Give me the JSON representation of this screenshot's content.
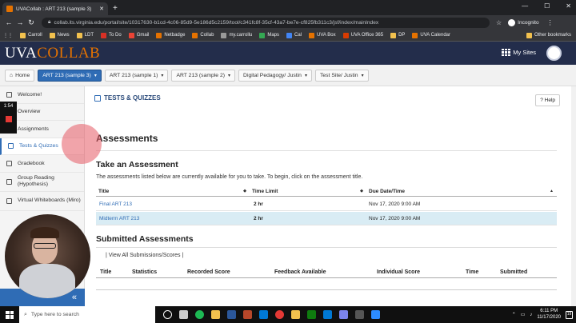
{
  "browser": {
    "tab_title": "UVACollab : ART 213 (sample 3)",
    "url": "collab.its.virginia.edu/portal/site/10317630-b1cd-4c06-85d9-5e186d5c2159/tool/c341fc8f-35cf-43a7-be7e-cf825fb311c3/jsf/index/mainIndex",
    "incognito_label": "Incognito",
    "bookmarks": [
      "Carroll",
      "News",
      "LDT",
      "To Do",
      "Gmail",
      "Netbadge",
      "Collab",
      "my.carrollu",
      "Maps",
      "Cal",
      "UVA Box",
      "UVA Office 365",
      "DP",
      "UVA Calendar"
    ],
    "other_bookmarks": "Other bookmarks"
  },
  "header": {
    "logo_uva": "UVA",
    "logo_collab": "COLLAB",
    "my_sites": "My Sites"
  },
  "site_nav": [
    {
      "label": "Home"
    },
    {
      "label": "ART 213 (sample 3)"
    },
    {
      "label": "ART 213 (sample 1)"
    },
    {
      "label": "ART 213 (sample 2)"
    },
    {
      "label": "Digital Pedagogy/ Justin"
    },
    {
      "label": "Test Site/ Justin"
    }
  ],
  "sidebar": {
    "items": [
      {
        "label": "Welcome!"
      },
      {
        "label": "Overview"
      },
      {
        "label": "Assignments"
      },
      {
        "label": "Tests & Quizzes"
      },
      {
        "label": "Gradebook"
      },
      {
        "label": "Group Reading (Hypothesis)"
      },
      {
        "label": "Virtual Whiteboards (Miro)"
      }
    ],
    "collapse_glyph": "«"
  },
  "recorder": {
    "time": "1:54"
  },
  "main": {
    "tool_title": "TESTS & QUIZZES",
    "help_label": "Help",
    "assessments_heading": "Assessments",
    "take_heading": "Take an Assessment",
    "take_intro": "The assessments listed below are currently available for you to take. To begin, click on the assessment title.",
    "columns": [
      "Title",
      "Time Limit",
      "Due Date/Time"
    ],
    "rows": [
      {
        "title": "Final ART 213",
        "time_limit": "2 hr",
        "due": "Nov 17, 2020 9:00 AM"
      },
      {
        "title": "Midterm ART 213",
        "time_limit": "2 hr",
        "due": "Nov 17, 2020 9:00 AM"
      }
    ],
    "submitted_heading": "Submitted Assessments",
    "view_all_link": "View All Submissions/Scores",
    "submitted_columns": [
      "Title",
      "Statistics",
      "Recorded Score",
      "Feedback Available",
      "Individual Score",
      "Time",
      "Submitted"
    ]
  },
  "taskbar": {
    "search_placeholder": "Type here to search",
    "time": "6:11 PM",
    "date": "11/17/2020",
    "notification_count": "19"
  }
}
